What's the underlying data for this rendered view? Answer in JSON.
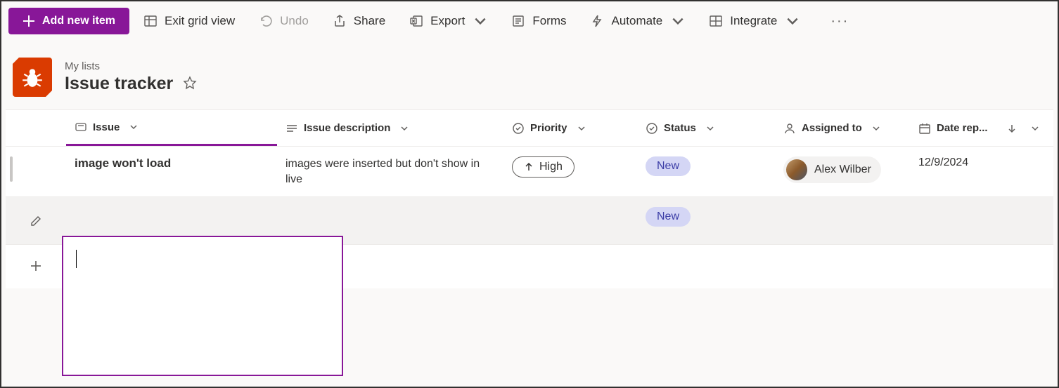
{
  "toolbar": {
    "add_label": "Add new item",
    "exit_grid": "Exit grid view",
    "undo": "Undo",
    "share": "Share",
    "export": "Export",
    "forms": "Forms",
    "automate": "Automate",
    "integrate": "Integrate"
  },
  "breadcrumb": "My lists",
  "list_title": "Issue tracker",
  "columns": {
    "issue": "Issue",
    "description": "Issue description",
    "priority": "Priority",
    "status": "Status",
    "assigned_to": "Assigned to",
    "date_reported": "Date rep..."
  },
  "rows": [
    {
      "issue": "image won't load",
      "description": "images were inserted but don't show in live",
      "priority": "High",
      "status": "New",
      "assigned_to": "Alex Wilber",
      "date_reported": "12/9/2024"
    },
    {
      "issue": "",
      "description": "",
      "priority": "",
      "status": "New",
      "assigned_to": "",
      "date_reported": ""
    }
  ],
  "colors": {
    "accent": "#881798",
    "list_icon_bg": "#da3b01",
    "status_new_bg": "#d4d6f5",
    "status_new_fg": "#3b3da6"
  }
}
